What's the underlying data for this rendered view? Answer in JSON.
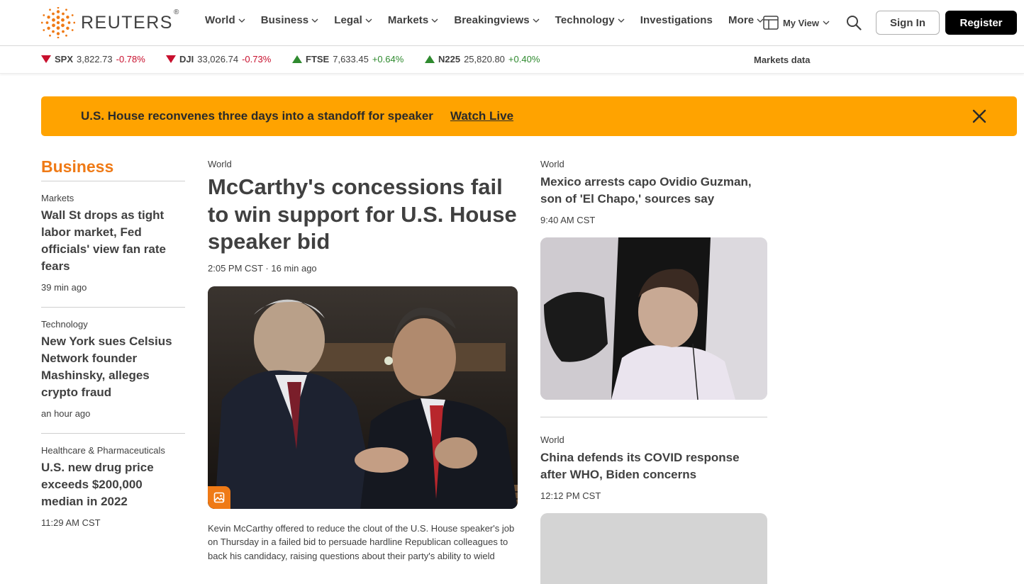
{
  "brand": {
    "name": "REUTERS",
    "reg": "®",
    "accent": "#ef7a16",
    "banner_color": "#ffa300"
  },
  "nav": {
    "items": [
      {
        "label": "World",
        "dropdown": true
      },
      {
        "label": "Business",
        "dropdown": true
      },
      {
        "label": "Legal",
        "dropdown": true
      },
      {
        "label": "Markets",
        "dropdown": true
      },
      {
        "label": "Breakingviews",
        "dropdown": true
      },
      {
        "label": "Technology",
        "dropdown": true
      },
      {
        "label": "Investigations",
        "dropdown": false
      },
      {
        "label": "More",
        "dropdown": true
      }
    ],
    "my_view": "My View",
    "sign_in": "Sign In",
    "register": "Register"
  },
  "ticker": {
    "items": [
      {
        "symbol": "SPX",
        "value": "3,822.73",
        "change": "-0.78%",
        "direction": "down"
      },
      {
        "symbol": "DJI",
        "value": "33,026.74",
        "change": "-0.73%",
        "direction": "down"
      },
      {
        "symbol": "FTSE",
        "value": "7,633.45",
        "change": "+0.64%",
        "direction": "up"
      },
      {
        "symbol": "N225",
        "value": "25,820.80",
        "change": "+0.40%",
        "direction": "up"
      }
    ],
    "markets_data_label": "Markets data"
  },
  "banner": {
    "text": "U.S. House reconvenes three days into a standoff for speaker",
    "link": "Watch Live"
  },
  "left_column": {
    "section_title": "Business",
    "stories": [
      {
        "kicker": "Markets",
        "headline": "Wall St drops as tight labor market, Fed officials' view fan rate fears",
        "time": "39 min ago"
      },
      {
        "kicker": "Technology",
        "headline": "New York sues Celsius Network founder Mashinsky, alleges crypto fraud",
        "time": "an hour ago"
      },
      {
        "kicker": "Healthcare & Pharmaceuticals",
        "headline": "U.S. new drug price exceeds $200,000 median in 2022",
        "time": "11:29 AM CST"
      }
    ]
  },
  "main_story": {
    "kicker": "World",
    "headline": "McCarthy's concessions fail to win support for U.S. House speaker bid",
    "time": "2:05 PM CST · 16 min ago",
    "summary": "Kevin McCarthy offered to reduce the clout of the U.S. House speaker's job on Thursday in a failed bid to persuade hardline Republican colleagues to back his candidacy, raising questions about their party's ability to wield"
  },
  "right_column": {
    "stories": [
      {
        "kicker": "World",
        "headline": "Mexico arrests capo Ovidio Guzman, son of 'El Chapo,' sources say",
        "time": "9:40 AM CST"
      },
      {
        "kicker": "World",
        "headline": "China defends its COVID response after WHO, Biden concerns",
        "time": "12:12 PM CST"
      }
    ]
  }
}
